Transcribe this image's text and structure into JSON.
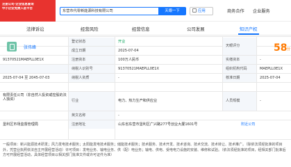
{
  "brand": {
    "line1": "注册公司·企业信息查询",
    "line2": "中小企业免费入驻平台"
  },
  "search": {
    "value": "东营市代零新能源科技有限公司",
    "button_label": "天眼一下"
  },
  "app": {
    "label": "应用"
  },
  "nav": {
    "items": [
      "商务合作",
      "企业服务"
    ]
  },
  "tabs": [
    {
      "label": "法律诉讼",
      "active": false
    },
    {
      "label": "经营风险",
      "active": false
    },
    {
      "label": "经营信息",
      "active": false
    },
    {
      "label": "公司发展",
      "active": false
    },
    {
      "label": "知识产权",
      "active": true
    }
  ],
  "info": {
    "legal_person": "张伟峰",
    "rows": [
      {
        "label": "登记状态",
        "value": "开业",
        "label2": "天眼评分",
        "value2": ""
      },
      {
        "label": "成立日期",
        "value": "2025-07-04",
        "label2": "",
        "value2": ""
      },
      {
        "label": "注册资本",
        "value": "100万人民币",
        "label2": "实缴资本",
        "value2": "-"
      },
      {
        "label": "纳税人识别号",
        "value": "91370521MAEPLL0E1X",
        "label2": "组织机构代码",
        "value2": "MAEPLL0E1X"
      },
      {
        "label": "纳税人资质",
        "value": "-",
        "label2": "核准日期",
        "value2": "2025-07-04"
      },
      {
        "label": "行业",
        "value": "电力、热力生产和供应业",
        "label2": "人员规模",
        "value2": "-"
      },
      {
        "label": "英文名称",
        "value": "-",
        "label2": "",
        "value2": ""
      },
      {
        "label": "注册地址",
        "value": "山东省东营市垦利区广兴路277号创业大厦1601号",
        "link": "附近公司",
        "label2": "",
        "value2": ""
      }
    ],
    "left_col": {
      "credit_code": "91370521MAEPLL0E1X",
      "business_term": "2025-07-04 至 2045-07-03",
      "company_type": "有限责任公司（非自然人投资或控股的法人独资）",
      "authority": "垦利区市场监督管理局"
    },
    "score": "58",
    "score_unit": "分"
  },
  "scope": {
    "text": "一般项目：新兴能源技术研发；风力发电技术服务；太阳能发电技术服务；储能技术服务；技术服务、技术开发、技术咨询、技术交流、技术转让、技术推广。（除依法须经批准的项目外，凭营业执照依法自主开展经营活动）许可项目：发电业务、输电业务、供（配）电业务；输电、供电、受电电力设施的安装、维修和试验。（依法须经批准的项目，经相关部门批准后方可开展经营活动，具体经营项目以相关部门批准文件或许可证件为准）"
  },
  "colors": {
    "accent": "#1677ff",
    "brand": "#e8332f",
    "score": "#ff7a00",
    "status": "#0aa35a"
  }
}
